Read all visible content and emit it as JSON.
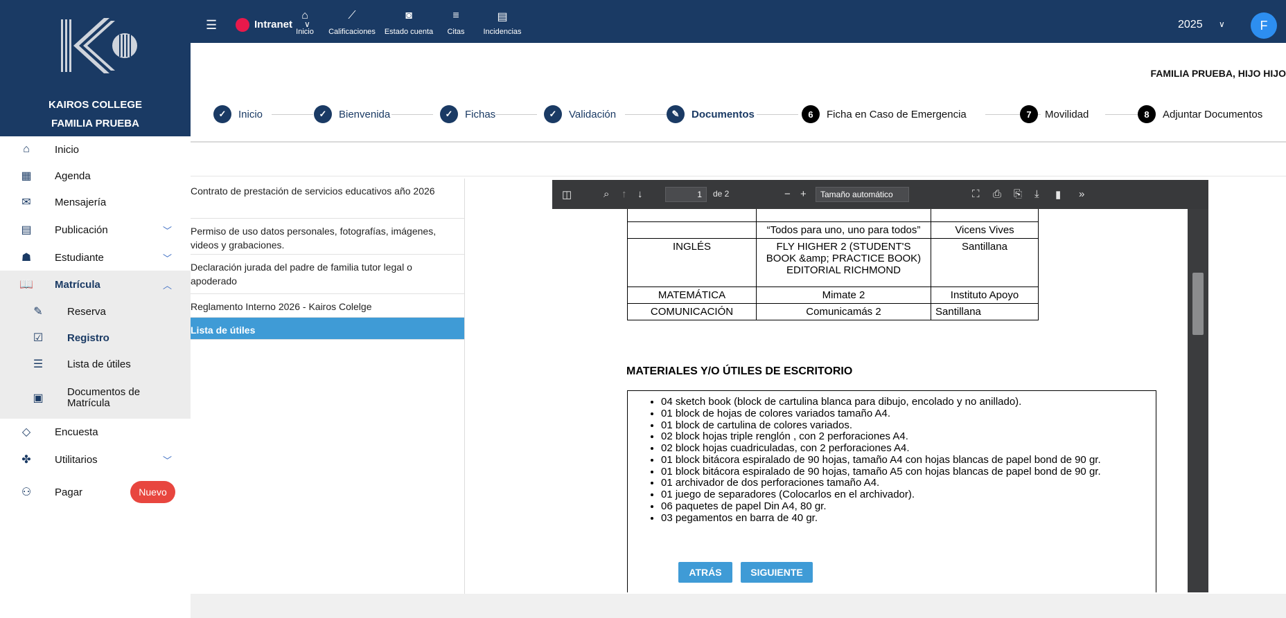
{
  "sidebar": {
    "college": "KAIROS COLLEGE",
    "family": "FAMILIA PRUEBA",
    "items": [
      {
        "label": "Inicio",
        "icon": "home-icon"
      },
      {
        "label": "Agenda",
        "icon": "calendar-icon"
      },
      {
        "label": "Mensajería",
        "icon": "message-icon"
      },
      {
        "label": "Publicación",
        "icon": "publication-icon"
      },
      {
        "label": "Estudiante",
        "icon": "student-icon"
      },
      {
        "label": "Matrícula",
        "icon": "book-icon"
      },
      {
        "label": "Reserva",
        "icon": "edit-icon"
      },
      {
        "label": "Registro",
        "icon": "register-icon"
      },
      {
        "label": "Lista de útiles",
        "icon": "list-icon"
      },
      {
        "label": "Documentos de Matrícula",
        "icon": "document-icon"
      },
      {
        "label": "Encuesta",
        "icon": "survey-icon"
      },
      {
        "label": "Utilitarios",
        "icon": "tools-icon"
      },
      {
        "label": "Pagar",
        "icon": "pay-icon"
      }
    ],
    "badge": "Nuevo"
  },
  "topbar": {
    "app": "Intranet",
    "nav": [
      {
        "label": "Inicio",
        "icon": "home-icon"
      },
      {
        "label": "Calificaciones",
        "icon": "chart-icon"
      },
      {
        "label": "Estado cuenta",
        "icon": "money-icon"
      },
      {
        "label": "Citas",
        "icon": "list-icon"
      },
      {
        "label": "Incidencias",
        "icon": "file-icon"
      }
    ],
    "year": "2025",
    "avatar": "F"
  },
  "user": "FAMILIA PRUEBA, HIJO HIJO",
  "steps": [
    {
      "label": "Inicio",
      "marker": "✓"
    },
    {
      "label": "Bienvenida",
      "marker": "✓"
    },
    {
      "label": "Fichas",
      "marker": "✓"
    },
    {
      "label": "Validación",
      "marker": "✓"
    },
    {
      "label": "Documentos",
      "marker": "✎"
    },
    {
      "label": "Ficha en Caso de Emergencia",
      "marker": "6"
    },
    {
      "label": "Movilidad",
      "marker": "7"
    },
    {
      "label": "Adjuntar Documentos",
      "marker": "8"
    }
  ],
  "documents": [
    "Contrato de prestación de servicios educativos año 2026",
    "Permiso de uso datos personales, fotografías, imágenes, videos y grabaciones.",
    "Declaración jurada del padre de familia tutor legal o apoderado",
    "Reglamento Interno 2026 - Kairos Colelge",
    "Lista de útiles"
  ],
  "pdf": {
    "page": "1",
    "of": "de 2",
    "zoom": "Tamaño automático",
    "book_rows": [
      {
        "area": "",
        "title": "“Todos para uno, uno para todos”",
        "publisher": "Vicens Vives"
      },
      {
        "area": "INGLÉS",
        "title": "FLY HIGHER 2 (STUDENT'S BOOK &amp; PRACTICE BOOK) EDITORIAL RICHMOND",
        "publisher": "Santillana"
      },
      {
        "area": "MATEMÁTICA",
        "title": "Mimate 2",
        "publisher": "Instituto Apoyo"
      },
      {
        "area": "COMUNICACIÓN",
        "title": "Comunicamás 2",
        "publisher": "Santillana"
      }
    ],
    "materials_title": "MATERIALES Y/O ÚTILES DE ESCRITORIO",
    "materials": [
      "04 sketch book (block de cartulina blanca para dibujo, encolado y no anillado).",
      "01 block de hojas de colores variados tamaño A4.",
      "01 block de cartulina de colores variados.",
      "02 block hojas triple renglón , con 2 perforaciones A4.",
      "02 block hojas cuadriculadas, con 2 perforaciones A4.",
      "01 block bitácora espiralado de 90 hojas, tamaño A4 con hojas blancas de papel bond de 90 gr.",
      "01 block bitácora espiralado de 90 hojas, tamaño A5 con hojas blancas de papel bond de 90 gr.",
      "01 archivador de dos perforaciones tamaño A4.",
      "01 juego de separadores (Colocarlos en el archivador).",
      "06 paquetes de papel Din A4, 80 gr.",
      "03 pegamentos en barra de 40 gr."
    ]
  },
  "buttons": {
    "back": "ATRÁS",
    "next": "SIGUIENTE"
  },
  "colors": {
    "navy": "#1a3a64",
    "accent": "#3f9bd6",
    "badge": "#e8463f"
  }
}
